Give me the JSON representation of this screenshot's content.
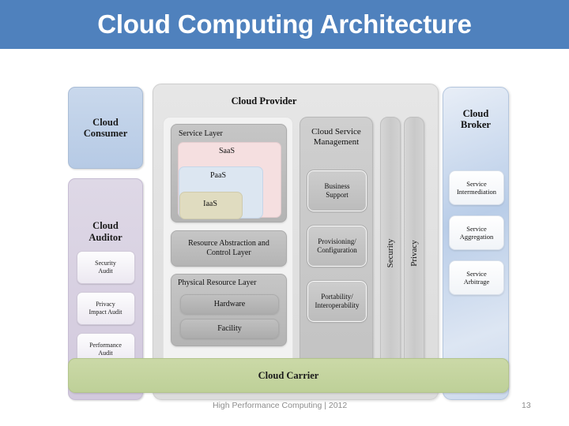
{
  "slide": {
    "title": "Cloud Computing Architecture",
    "title_bar_color": "#4f81bd"
  },
  "diagram": {
    "consumer": {
      "label": "Cloud\nConsumer",
      "line1": "Cloud",
      "line2": "Consumer",
      "color": "#bdcfe7"
    },
    "auditor": {
      "title_line1": "Cloud",
      "title_line2": "Auditor",
      "color": "#d9d2e0",
      "items": [
        {
          "line1": "Security",
          "line2": "Audit"
        },
        {
          "line1": "Privacy",
          "line2": "Impact Audit"
        },
        {
          "line1": "Performance",
          "line2": "Audit"
        }
      ]
    },
    "provider": {
      "title": "Cloud Provider",
      "color": "#e0e0e0",
      "service_layer": {
        "label": "Service Layer",
        "saas": {
          "label": "SaaS",
          "color": "#f5dfe0"
        },
        "paas": {
          "label": "PaaS",
          "color": "#dce6f1"
        },
        "iaas": {
          "label": "IaaS",
          "color": "#e0dcc0"
        }
      },
      "resource_abstraction": {
        "line1": "Resource Abstraction and",
        "line2": "Control Layer"
      },
      "physical_resource": {
        "label": "Physical Resource Layer",
        "hardware": "Hardware",
        "facility": "Facility"
      }
    },
    "service_management": {
      "title_line1": "Cloud Service",
      "title_line2": "Management",
      "items": [
        {
          "line1": "Business",
          "line2": "Support"
        },
        {
          "line1": "Provisioning/",
          "line2": "Configuration"
        },
        {
          "line1": "Portability/",
          "line2": "Interoperability"
        }
      ]
    },
    "vertical_bars": {
      "security": "Security",
      "privacy": "Privacy"
    },
    "broker": {
      "title_line1": "Cloud",
      "title_line2": "Broker",
      "items": [
        {
          "line1": "Service",
          "line2": "Intermediation"
        },
        {
          "line1": "Service",
          "line2": "Aggregation"
        },
        {
          "line1": "Service",
          "line2": "Arbitrage"
        }
      ]
    },
    "carrier": {
      "label": "Cloud Carrier",
      "color": "#c3d69b"
    }
  },
  "footer": {
    "text": "High Performance Computing | 2012",
    "page_number": "13"
  }
}
